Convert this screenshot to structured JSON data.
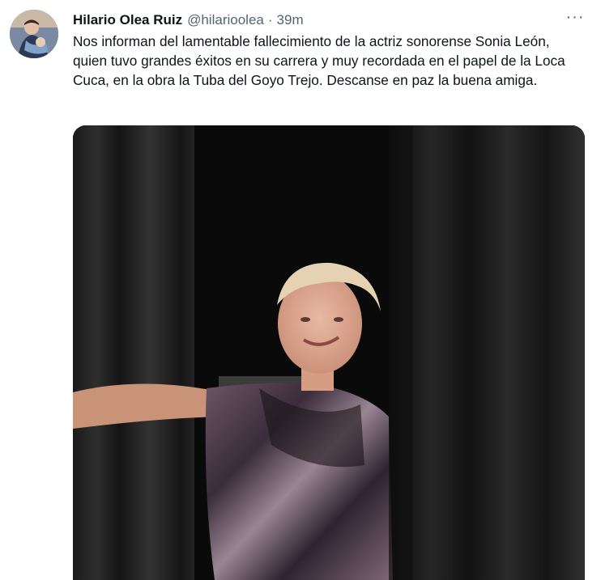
{
  "tweet": {
    "author_name": "Hilario Olea Ruiz",
    "author_handle": "@hilarioolea",
    "separator": "·",
    "time": "39m",
    "more_label": "···",
    "text": "Nos informan del lamentable fallecimiento de la actriz sonorense Sonia León, quien tuvo grandes éxitos en su carrera y muy recordada en el papel de la Loca Cuca, en la obra la Tuba del Goyo Trejo. Descanse en paz la buena amiga."
  },
  "icons": {
    "more": "more-options-icon",
    "avatar": "profile-photo"
  },
  "colors": {
    "text_primary": "#0f1419",
    "text_secondary": "#536471",
    "background": "#ffffff"
  }
}
